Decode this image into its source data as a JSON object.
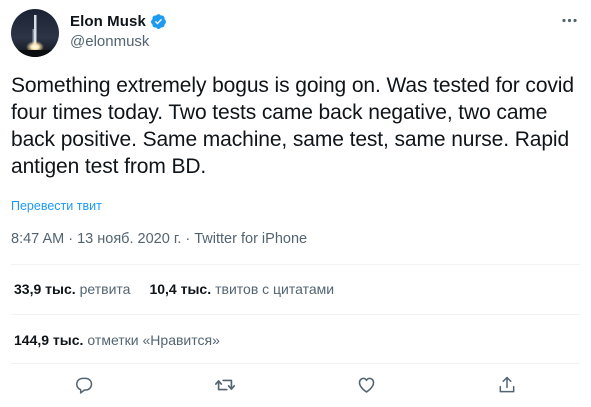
{
  "author": {
    "name": "Elon Musk",
    "handle": "@elonmusk",
    "verified": true
  },
  "tweet": {
    "text": "Something extremely bogus is going on. Was tested for covid four times today. Two tests came back negative, two came back positive. Same machine, same test, same nurse. Rapid antigen test from BD.",
    "translate_link": "Перевести твит",
    "meta": "8:47 AM · 13 нояб. 2020 г. · Twitter for iPhone"
  },
  "stats": {
    "retweets_count": "33,9 тыс.",
    "retweets_label": "ретвита",
    "quotes_count": "10,4 тыс.",
    "quotes_label": "твитов с цитатами",
    "likes_count": "144,9 тыс.",
    "likes_label": "отметки «Нравится»"
  },
  "icons": {
    "more": "more-icon",
    "verified": "verified-badge-icon",
    "reply": "reply-icon",
    "retweet": "retweet-icon",
    "like": "like-icon",
    "share": "share-icon"
  },
  "colors": {
    "accent": "#1d9bf0",
    "text": "#0f1419",
    "secondary": "#536471",
    "divider": "#eff3f4"
  }
}
